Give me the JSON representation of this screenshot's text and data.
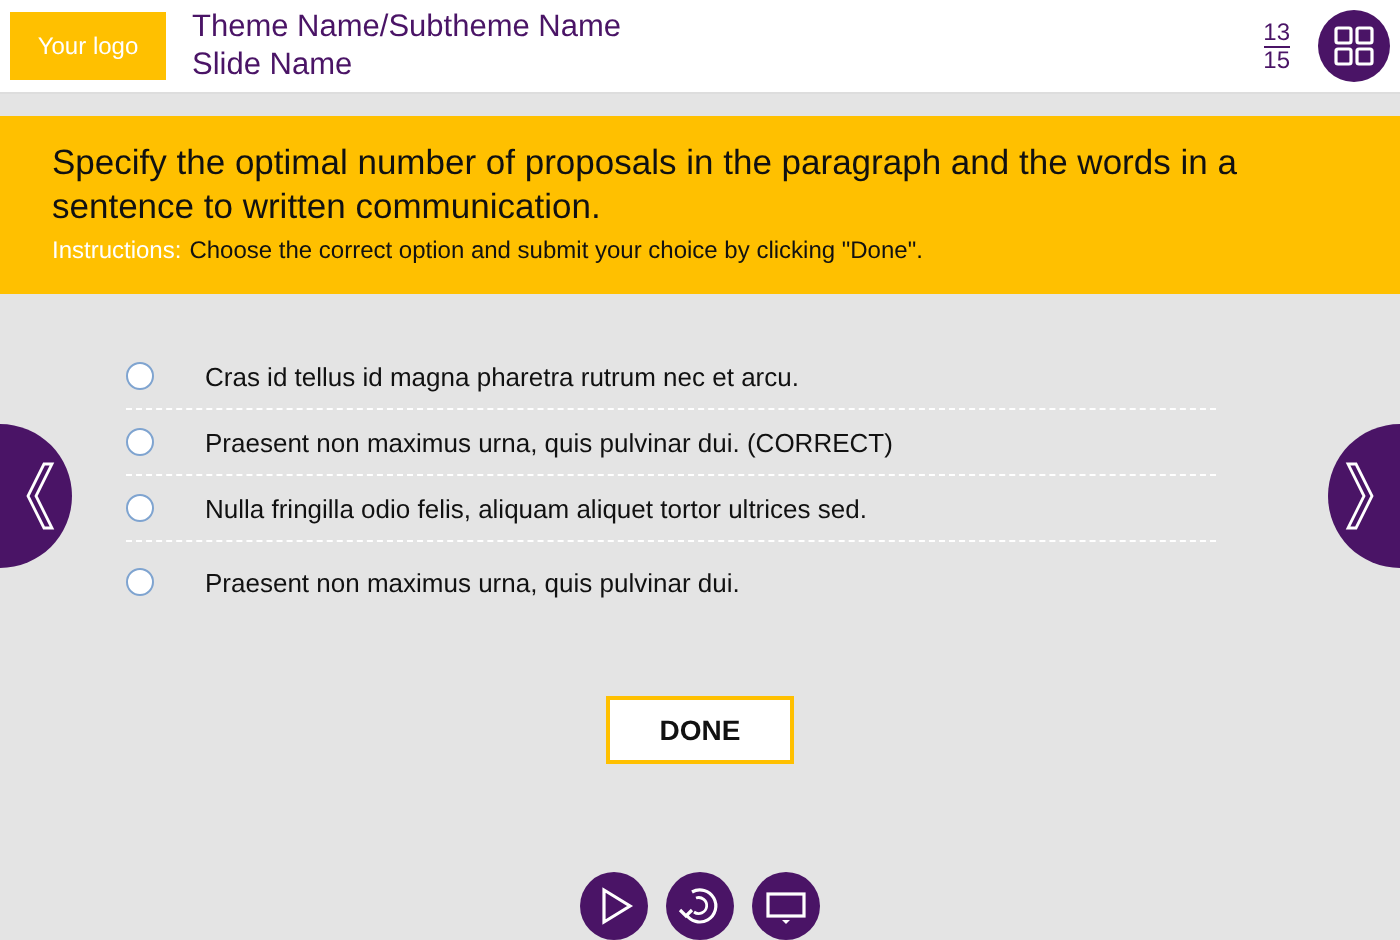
{
  "header": {
    "logo": "Your logo",
    "theme": "Theme Name/Subtheme Name",
    "slide": "Slide Name",
    "page_current": "13",
    "page_total": "15"
  },
  "question": {
    "text": "Specify the optimal number of proposals in the paragraph and the words in a sentence to written communication.",
    "instructions_label": "Instructions:",
    "instructions": "Choose the correct option and submit your choice by clicking \"Done\"."
  },
  "options": [
    {
      "label": "Cras id tellus id magna pharetra rutrum nec et arcu.",
      "selected": false
    },
    {
      "label": "Praesent non maximus urna, quis pulvinar dui. (CORRECT)",
      "selected": false
    },
    {
      "label": "Nulla fringilla odio felis, aliquam aliquet tortor ultrices sed.",
      "selected": false
    },
    {
      "label": "Praesent non maximus urna, quis pulvinar dui.",
      "selected": false
    }
  ],
  "done_button": "DONE"
}
